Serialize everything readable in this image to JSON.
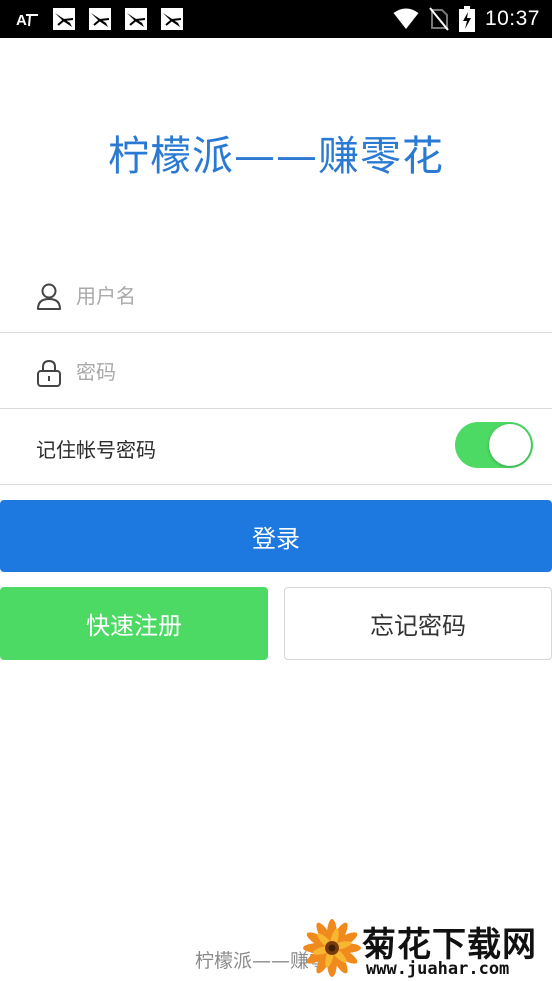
{
  "status_bar": {
    "time": "10:37",
    "left_icons": [
      "font-accessibility-icon",
      "app-notification-icon",
      "app-notification-icon",
      "app-notification-icon",
      "app-notification-icon"
    ],
    "right_icons": [
      "wifi-icon",
      "no-sim-icon",
      "battery-charging-icon"
    ]
  },
  "app": {
    "title": "柠檬派——赚零花"
  },
  "form": {
    "username_placeholder": "用户名",
    "username_value": "",
    "password_placeholder": "密码",
    "password_value": "",
    "remember_label": "记住帐号密码",
    "remember_on": true
  },
  "buttons": {
    "login": "登录",
    "register": "快速注册",
    "forgot": "忘记密码"
  },
  "footer": {
    "text": "柠檬派——赚零花"
  },
  "watermark": {
    "title": "菊花下载网",
    "url": "www.juahar.com"
  },
  "colors": {
    "title_blue": "#2a79d3",
    "login_blue": "#1d78e0",
    "green": "#4cd964",
    "status_bar": "#000000"
  }
}
